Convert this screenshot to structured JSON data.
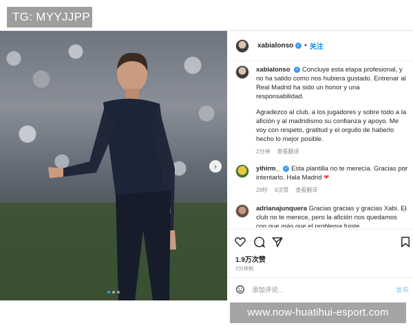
{
  "badge": {
    "text": "TG: MYYJJPP"
  },
  "header": {
    "username": "xabialonso",
    "separator": "•",
    "follow_label": "关注"
  },
  "caption": {
    "username": "xabialonso",
    "text1": "Concluye esta etapa profesional, y no ha salido como nos hubiera gustado. Entrenar al Real Madrid ha sido un honor y una responsabilidad.",
    "text2": "Agradezco al club, a los jugadores y sobre todo a la afición y al madridismo su confianza y apoyo. Me voy con respeto, gratitud y el orgullo de haberlo hecho lo mejor posible.",
    "time": "2分钟",
    "translate": "查看翻译"
  },
  "comments": [
    {
      "username": "yihirm_",
      "text": "Esta plantilla no te merecía. Gracias por intentarlo. Hala Madrid",
      "time": "28秒",
      "likes": "9次赞",
      "translate": "查看翻译"
    },
    {
      "username": "adrianajunquera",
      "text": "Gracias gracias y gracias Xabi. El club no te merece, pero la afición nos quedamos con que más que el problema fuiste"
    }
  ],
  "stats": {
    "likes": "1.9万次赞",
    "time": "2分钟前"
  },
  "add_comment": {
    "placeholder": "添加评论...",
    "post_label": "发布"
  },
  "watermark": {
    "text": "www.now-huatihui-esport.com"
  },
  "colors": {
    "link": "#0095f6",
    "verified": "#3897f0",
    "heart_red": "#ed4956",
    "muted": "#8e8e8e"
  },
  "icons": [
    "heart-icon",
    "comment-icon",
    "share-icon",
    "bookmark-icon",
    "emoji-icon",
    "verified-icon",
    "next-arrow-icon"
  ]
}
